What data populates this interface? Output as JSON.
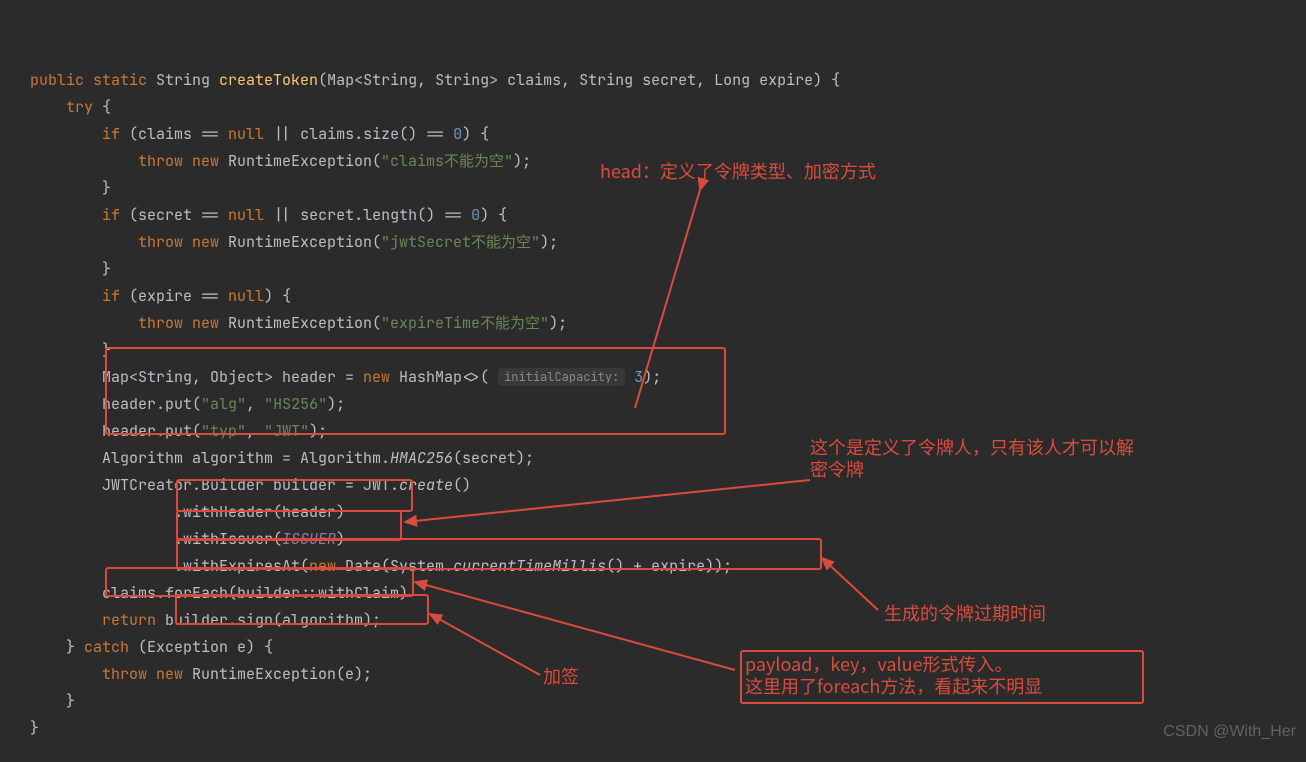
{
  "code": {
    "l1": {
      "p1": "public ",
      "p2": "static ",
      "p3": "String ",
      "p4": "createToken",
      "p5": "(Map<String, String> claims, String secret, Long expire) {"
    },
    "l2": {
      "p1": "try ",
      "p2": "{"
    },
    "l3": {
      "p1": "if ",
      "p2": "(claims == ",
      "p3": "null ",
      "p4": "|| claims.size() == ",
      "p5": "0",
      "p6": ") {"
    },
    "l4": {
      "p1": "throw new ",
      "p2": "RuntimeException(",
      "p3": "\"claims不能为空\"",
      "p4": ");"
    },
    "l5": "}",
    "l6": {
      "p1": "if ",
      "p2": "(secret == ",
      "p3": "null ",
      "p4": "|| secret.length() == ",
      "p5": "0",
      "p6": ") {"
    },
    "l7": {
      "p1": "throw new ",
      "p2": "RuntimeException(",
      "p3": "\"jwtSecret不能为空\"",
      "p4": ");"
    },
    "l8": "}",
    "l9": {
      "p1": "if ",
      "p2": "(expire == ",
      "p3": "null",
      "p4": ") {"
    },
    "l10": {
      "p1": "throw new ",
      "p2": "RuntimeException(",
      "p3": "\"expireTime不能为空\"",
      "p4": ");"
    },
    "l11": "}",
    "l12": {
      "p1": "Map<String, Object> header = ",
      "p2": "new ",
      "p3": "HashMap<>( ",
      "hint": "initialCapacity:",
      "p4": " 3",
      "p5": ");"
    },
    "l13": {
      "p1": "header.put(",
      "p2": "\"alg\"",
      "p3": ", ",
      "p4": "\"HS256\"",
      "p5": ");"
    },
    "l14": {
      "p1": "header.put(",
      "p2": "\"typ\"",
      "p3": ", ",
      "p4": "\"JWT\"",
      "p5": ");"
    },
    "l15": {
      "p1": "Algorithm algorithm = Algorithm.",
      "p2": "HMAC256",
      "p3": "(secret);"
    },
    "l16": {
      "p1": "JWTCreator.Builder builder = JWT.",
      "p2": "create",
      "p3": "()"
    },
    "l17": {
      "p1": ".withHeader(header)"
    },
    "l18": {
      "p1": ".withIssuer(",
      "p2": "ISSUER",
      "p3": ")"
    },
    "l19": {
      "p1": ".withExpiresAt(",
      "p2": "new ",
      "p3": "Date(System.",
      "p4": "currentTimeMillis",
      "p5": "() + expire));"
    },
    "l20": {
      "p1": "claims.forEach(builder::withClaim)"
    },
    "l21": {
      "p1": "return ",
      "p2": "builder.sign(algorithm);"
    },
    "l22": {
      "p1": "} ",
      "p2": "catch ",
      "p3": "(Exception e) {"
    },
    "l23": {
      "p1": "throw new ",
      "p2": "RuntimeException(e);"
    },
    "l24": "}",
    "l25": "}"
  },
  "annotations": {
    "head": "head：定义了令牌类型、加密方式",
    "issuer": "这个是定义了令牌人，只有该人才可以解密令牌",
    "expire": "生成的令牌过期时间",
    "payload": "payload，key，value形式传入。\n这里用了foreach方法，看起来不明显",
    "sign": "加签"
  },
  "watermark": "CSDN @With_Her"
}
